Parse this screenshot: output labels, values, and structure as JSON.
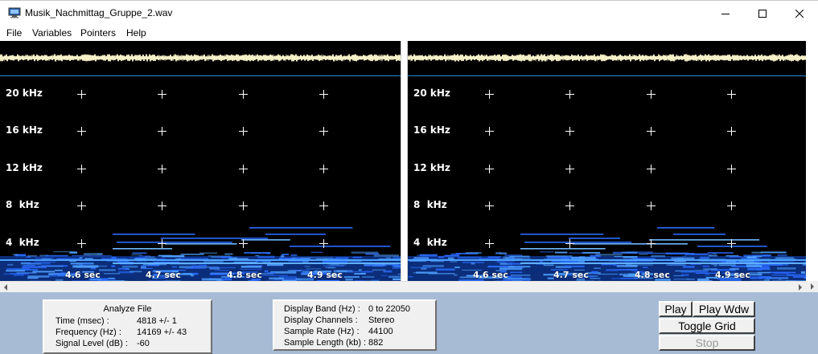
{
  "window": {
    "title": "Musik_Nachmittag_Gruppe_2.wav",
    "icon": "computer-monitor-icon",
    "controls": [
      "minimize-icon",
      "maximize-icon",
      "close-icon"
    ]
  },
  "menu": {
    "items": [
      {
        "label": "File"
      },
      {
        "label": "Variables"
      },
      {
        "label": "Pointers"
      },
      {
        "label": "Help"
      }
    ]
  },
  "spectrogram": {
    "frequency_labels": [
      "20 kHz",
      "16 kHz",
      "12 kHz",
      "8  kHz",
      "4  kHz"
    ],
    "time_labels": [
      "4.6 sec",
      "4.7 sec",
      "4.8 sec",
      "4.9 sec"
    ],
    "colors": {
      "background": "#000000",
      "waveform": "#f5f0c8",
      "baseline": "#2c8ad8",
      "energy": "#2a6bff",
      "grid_marker": "#ffffff"
    }
  },
  "analyze_file": {
    "title": "Analyze File",
    "rows": [
      {
        "label": "Time (msec) :",
        "value": "4818 +/- 1"
      },
      {
        "label": "Frequency (Hz) :",
        "value": "14169 +/- 43"
      },
      {
        "label": "Signal Level (dB) :",
        "value": "-60"
      }
    ]
  },
  "display_info": {
    "rows": [
      {
        "label": "Display Band (Hz) :",
        "value": "0 to 22050"
      },
      {
        "label": "Display Channels :",
        "value": "Stereo"
      },
      {
        "label": "Sample Rate (Hz) :",
        "value": "44100"
      },
      {
        "label": "Sample Length (kb) :",
        "value": "882"
      }
    ]
  },
  "buttons": {
    "play": "Play",
    "play_window": "Play Wdw",
    "toggle_grid": "Toggle Grid",
    "stop": "Stop"
  },
  "colors": {
    "bottom_panel": "#a7bbd4",
    "button_face": "#f0f0f0",
    "disabled_text": "#9a9a9a"
  }
}
